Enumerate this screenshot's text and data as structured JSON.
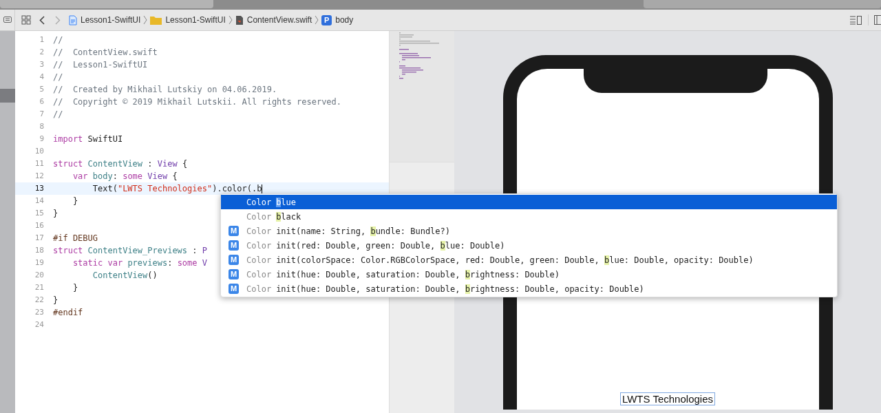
{
  "breadcrumb": [
    {
      "kind": "project",
      "label": "Lesson1-SwiftUI"
    },
    {
      "kind": "folder",
      "label": "Lesson1-SwiftUI"
    },
    {
      "kind": "file",
      "label": "ContentView.swift"
    },
    {
      "kind": "property",
      "badge": "P",
      "label": "body"
    }
  ],
  "editor": {
    "lines": [
      {
        "number": "1",
        "current": false,
        "tokens": [
          {
            "kind": "comment",
            "text": "//"
          }
        ]
      },
      {
        "number": "2",
        "current": false,
        "tokens": [
          {
            "kind": "comment",
            "text": "//  ContentView.swift"
          }
        ]
      },
      {
        "number": "3",
        "current": false,
        "tokens": [
          {
            "kind": "comment",
            "text": "//  Lesson1-SwiftUI"
          }
        ]
      },
      {
        "number": "4",
        "current": false,
        "tokens": [
          {
            "kind": "comment",
            "text": "//"
          }
        ]
      },
      {
        "number": "5",
        "current": false,
        "tokens": [
          {
            "kind": "comment",
            "text": "//  Created by Mikhail Lutskiy on 04.06.2019."
          }
        ]
      },
      {
        "number": "6",
        "current": false,
        "tokens": [
          {
            "kind": "comment",
            "text": "//  Copyright © 2019 Mikhail Lutskii. All rights reserved."
          }
        ]
      },
      {
        "number": "7",
        "current": false,
        "tokens": [
          {
            "kind": "comment",
            "text": "//"
          }
        ]
      },
      {
        "number": "8",
        "current": false
      },
      {
        "number": "9",
        "current": false,
        "tokens": [
          {
            "kind": "keyword",
            "text": "import"
          },
          {
            "kind": "plain",
            "text": " SwiftUI"
          }
        ]
      },
      {
        "number": "10",
        "current": false
      },
      {
        "number": "11",
        "current": false,
        "tokens": [
          {
            "kind": "keyword",
            "text": "struct "
          },
          {
            "kind": "ident",
            "text": "ContentView"
          },
          {
            "kind": "plain",
            "text": " : "
          },
          {
            "kind": "type",
            "text": "View"
          },
          {
            "kind": "plain",
            "text": " {"
          }
        ]
      },
      {
        "number": "12",
        "current": false,
        "tokens": [
          {
            "kind": "keyword",
            "text": "    var "
          },
          {
            "kind": "ident",
            "text": "body"
          },
          {
            "kind": "plain",
            "text": ": "
          },
          {
            "kind": "keyword",
            "text": "some "
          },
          {
            "kind": "type",
            "text": "View"
          },
          {
            "kind": "plain",
            "text": " {"
          }
        ]
      },
      {
        "number": "13",
        "current": true,
        "tokens": [
          {
            "kind": "plain",
            "text": "        Text("
          },
          {
            "kind": "string",
            "text": "\"LWTS Technologies\""
          },
          {
            "kind": "plain",
            "text": ").color(.b"
          }
        ]
      },
      {
        "number": "14",
        "current": false,
        "tokens": [
          {
            "kind": "plain",
            "text": "    }"
          }
        ]
      },
      {
        "number": "15",
        "current": false,
        "tokens": [
          {
            "kind": "plain",
            "text": "}"
          }
        ]
      },
      {
        "number": "16",
        "current": false
      },
      {
        "number": "17",
        "current": false,
        "tokens": [
          {
            "kind": "preproc",
            "text": "#if DEBUG"
          }
        ]
      },
      {
        "number": "18",
        "current": false,
        "tokens": [
          {
            "kind": "keyword",
            "text": "struct "
          },
          {
            "kind": "ident",
            "text": "ContentView_Previews"
          },
          {
            "kind": "plain",
            "text": " : "
          },
          {
            "kind": "type",
            "text": "P"
          }
        ]
      },
      {
        "number": "19",
        "current": false,
        "tokens": [
          {
            "kind": "keyword",
            "text": "    static var "
          },
          {
            "kind": "ident",
            "text": "previews"
          },
          {
            "kind": "plain",
            "text": ": "
          },
          {
            "kind": "keyword",
            "text": "some "
          },
          {
            "kind": "type",
            "text": "V"
          }
        ]
      },
      {
        "number": "20",
        "current": false,
        "tokens": [
          {
            "kind": "ident",
            "text": "        ContentView"
          },
          {
            "kind": "plain",
            "text": "()"
          }
        ]
      },
      {
        "number": "21",
        "current": false,
        "tokens": [
          {
            "kind": "plain",
            "text": "    }"
          }
        ]
      },
      {
        "number": "22",
        "current": false,
        "tokens": [
          {
            "kind": "plain",
            "text": "}"
          }
        ]
      },
      {
        "number": "23",
        "current": false,
        "tokens": [
          {
            "kind": "preproc",
            "text": "#endif"
          }
        ]
      },
      {
        "number": "24",
        "current": false
      }
    ]
  },
  "completions": [
    {
      "selected": true,
      "type": "Color",
      "match": "b",
      "after": "lue"
    },
    {
      "selected": false,
      "type": "Color",
      "match": "b",
      "after": "lack"
    },
    {
      "badge": "M",
      "selected": false,
      "type": "Color",
      "before": "init(name: String, ",
      "match": "b",
      "after": "undle: Bundle?)"
    },
    {
      "badge": "M",
      "selected": false,
      "type": "Color",
      "before": "init(red: Double, green: Double, ",
      "match": "b",
      "after": "lue: Double)"
    },
    {
      "badge": "M",
      "selected": false,
      "type": "Color",
      "before": "init(colorSpace: Color.RGBColorSpace, red: Double, green: Double, ",
      "match": "b",
      "after": "lue: Double, opacity: Double)"
    },
    {
      "badge": "M",
      "selected": false,
      "type": "Color",
      "before": "init(hue: Double, saturation: Double, ",
      "match": "b",
      "after": "rightness: Double)"
    },
    {
      "badge": "M",
      "selected": false,
      "type": "Color",
      "before": "init(hue: Double, saturation: Double, ",
      "match": "b",
      "after": "rightness: Double, opacity: Double)"
    }
  ],
  "preview": {
    "text": "LWTS Technologies"
  }
}
